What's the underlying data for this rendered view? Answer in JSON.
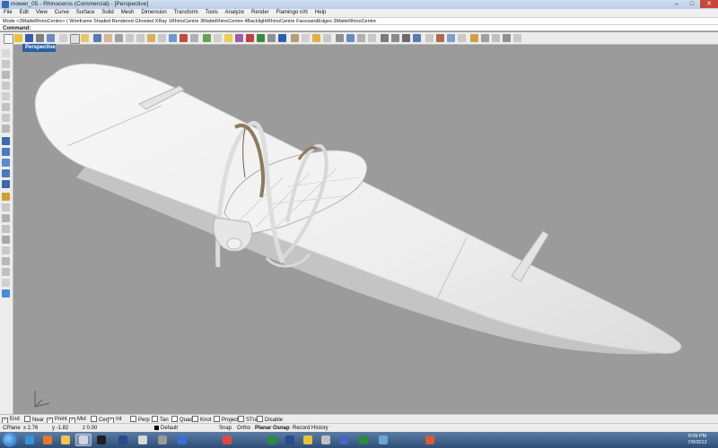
{
  "window": {
    "title": "mower_05 - Rhinoceros (Commercial) - [Perspective]",
    "min_glyph": "–",
    "max_glyph": "□",
    "close_glyph": "✕"
  },
  "menubar": {
    "items": [
      "File",
      "Edit",
      "View",
      "Curve",
      "Surface",
      "Solid",
      "Mesh",
      "Dimension",
      "Transform",
      "Tools",
      "Analyze",
      "Render",
      "Flamingo nXt",
      "Help"
    ]
  },
  "command": {
    "history": "Mode <3MatteRhinoCentre> ( Wireframe  Shaded  Rendered  Ghosted  XRay  1RhinoCentre  3MatteRhinoCentre  4BacklightRhinoCentre  FacesandEdges  3MatteRhinoCentre",
    "prompt_label": "Command:"
  },
  "viewport": {
    "tab_label": "Perspective",
    "background": "#9b9b9b"
  },
  "osnap": {
    "items": [
      {
        "label": "End",
        "checked": true
      },
      {
        "label": "Near",
        "checked": false
      },
      {
        "label": "Point",
        "checked": true
      },
      {
        "label": "Mid",
        "checked": true
      },
      {
        "label": "Cen",
        "checked": false
      },
      {
        "label": "Int",
        "checked": true
      },
      {
        "label": "Perp",
        "checked": false
      },
      {
        "label": "Tan",
        "checked": false
      },
      {
        "label": "Quad",
        "checked": false
      },
      {
        "label": "Knot",
        "checked": false
      },
      {
        "label": "Project",
        "checked": false
      },
      {
        "label": "STrack",
        "checked": false
      },
      {
        "label": "Disable",
        "checked": false
      }
    ]
  },
  "status": {
    "cplane": "CPlane",
    "x": "x 2.76",
    "y": "y -1.82",
    "z": "z 0.00",
    "layer": "Default",
    "snap": "Snap",
    "ortho": "Ortho",
    "planar": "Planar",
    "osnap": "Osnap",
    "record_history": "Record History"
  },
  "taskbar": {
    "time": "9:09 PM",
    "date": "7/9/2012",
    "apps": [
      {
        "name": "ie-icon",
        "color": "#3b8fd9"
      },
      {
        "name": "firefox-icon",
        "color": "#e8772e"
      },
      {
        "name": "explorer-icon",
        "color": "#f0c44c"
      },
      {
        "name": "rhino-icon",
        "color": "#cfd6dd",
        "active": true
      },
      {
        "name": "media-icon",
        "color": "#202020"
      },
      {
        "name": "photoshop-icon",
        "color": "#2a4a8a"
      },
      {
        "name": "spiral-icon",
        "color": "#d8d8d8"
      },
      {
        "name": "s-app-icon",
        "color": "#9a9a9a"
      },
      {
        "name": "word-icon",
        "color": "#3e6fd0"
      },
      {
        "name": "chrome-icon",
        "color": "#e14b3b"
      },
      {
        "name": "excel-icon",
        "color": "#2d8a3e"
      },
      {
        "name": "photoshop-icon-2",
        "color": "#2a4a8a"
      },
      {
        "name": "folder-icon",
        "color": "#e9c23a"
      },
      {
        "name": "camera-icon",
        "color": "#c0c0c0"
      },
      {
        "name": "eye-icon",
        "color": "#4a64c8"
      },
      {
        "name": "excel-icon-2",
        "color": "#2d8a3e"
      },
      {
        "name": "network-icon",
        "color": "#6aa5d8"
      },
      {
        "name": "tray-app-icon",
        "color": "#d85a3a"
      }
    ]
  }
}
